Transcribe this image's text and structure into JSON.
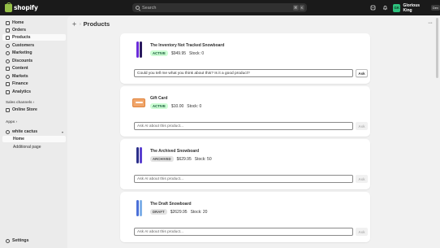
{
  "topbar": {
    "logo_text": "shopify",
    "search_placeholder": "Search",
    "shortcut_keys": [
      "⌘",
      "K"
    ],
    "icons": [
      "sidekick-icon",
      "bell-icon"
    ],
    "store_initials": "GK",
    "store_name": "Glorious King",
    "dev_badge": "Dev"
  },
  "sidebar": {
    "items": [
      {
        "label": "Home",
        "icon": "home-icon"
      },
      {
        "label": "Orders",
        "icon": "orders-icon"
      },
      {
        "label": "Products",
        "icon": "tag-icon"
      },
      {
        "label": "Customers",
        "icon": "person-icon"
      },
      {
        "label": "Marketing",
        "icon": "target-icon"
      },
      {
        "label": "Discounts",
        "icon": "discount-icon"
      },
      {
        "label": "Content",
        "icon": "content-icon"
      },
      {
        "label": "Markets",
        "icon": "globe-icon"
      },
      {
        "label": "Finance",
        "icon": "bank-icon"
      },
      {
        "label": "Analytics",
        "icon": "chart-icon"
      }
    ],
    "sales_channels_label": "Sales channels",
    "online_store_label": "Online Store",
    "apps_label": "Apps",
    "app_name": "white cactus",
    "app_sub_items": [
      "Home",
      "Additional page"
    ],
    "settings_label": "Settings"
  },
  "main": {
    "page_title": "Products",
    "more_label": "···",
    "products": [
      {
        "title": "The Inventory Not Tracked Snowboard",
        "status": "ACTIVE",
        "price": "$949.95",
        "stock": "Stock: 0",
        "input_value": "Could you tell me what you think about this? Is it a good product?",
        "input_placeholder": "Ask AI about this product...",
        "ask_label": "Ask",
        "thumb_colors": [
          "#6a2bd9",
          "#2a1a5e"
        ]
      },
      {
        "title": "Gift Card",
        "status": "ACTIVE",
        "price": "$10.00",
        "stock": "Stock: 0",
        "input_value": "",
        "input_placeholder": "Ask AI about this product...",
        "ask_label": "Ask",
        "thumb_colors": [
          "#f0a56a"
        ]
      },
      {
        "title": "The Archived Snowboard",
        "status": "ARCHIVED",
        "price": "$629.95",
        "stock": "Stock: 50",
        "input_value": "",
        "input_placeholder": "Ask AI about this product...",
        "ask_label": "Ask",
        "thumb_colors": [
          "#2b2f8a",
          "#5a3fd0"
        ]
      },
      {
        "title": "The Draft Snowboard",
        "status": "DRAFT",
        "price": "$2629.95",
        "stock": "Stock: 20",
        "input_value": "",
        "input_placeholder": "Ask AI about this product...",
        "ask_label": "Ask",
        "thumb_colors": [
          "#4a6fd8",
          "#7fb0e8"
        ]
      }
    ]
  },
  "colors": {
    "topbar_bg": "#1a1a1a",
    "active_badge_bg": "#cdfed4",
    "brand_green": "#95bf47",
    "avatar_bg": "#2ec27e"
  }
}
